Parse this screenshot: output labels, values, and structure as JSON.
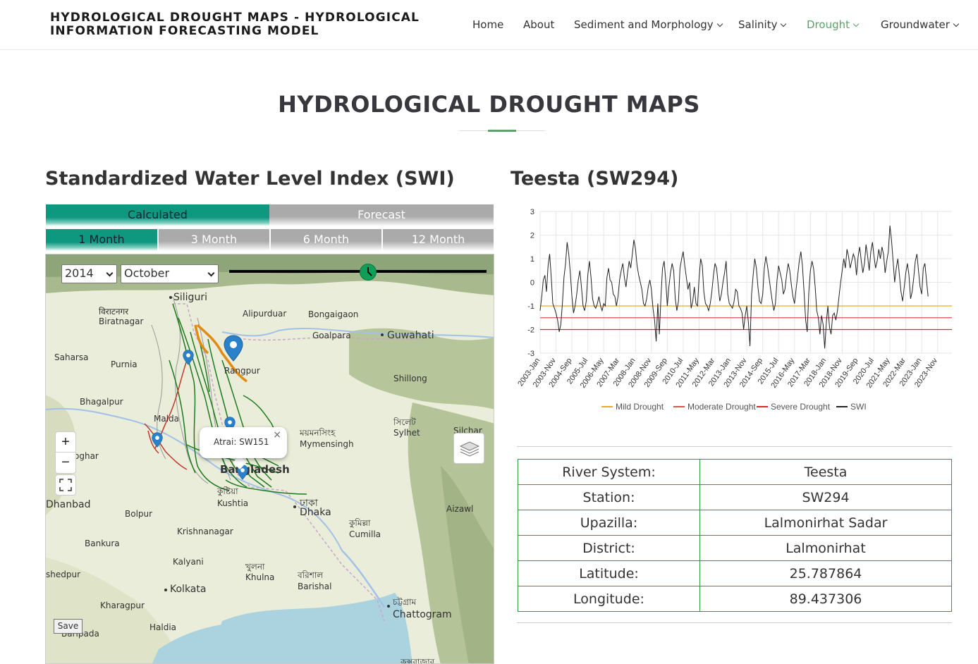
{
  "header": {
    "title_line1": "HYDROLOGICAL DROUGHT MAPS - HYDROLOGICAL",
    "title_line2": "INFORMATION FORECASTING MODEL",
    "nav": [
      {
        "label": "Home",
        "dropdown": false,
        "active": false
      },
      {
        "label": "About",
        "dropdown": false,
        "active": false
      },
      {
        "label": "Sediment and Morphology",
        "dropdown": true,
        "active": false
      },
      {
        "label": "Salinity",
        "dropdown": true,
        "active": false
      },
      {
        "label": "Drought",
        "dropdown": true,
        "active": true
      },
      {
        "label": "Groundwater",
        "dropdown": true,
        "active": false
      }
    ],
    "active_color": "#5aa469"
  },
  "page": {
    "heading": "HYDROLOGICAL DROUGHT MAPS"
  },
  "left": {
    "title": "Standardized Water Level Index (SWI)",
    "mode_tabs": [
      {
        "label": "Calculated",
        "active": true
      },
      {
        "label": "Forecast",
        "active": false
      }
    ],
    "period_tabs": [
      {
        "label": "1 Month",
        "active": true
      },
      {
        "label": "3 Month",
        "active": false
      },
      {
        "label": "6 Month",
        "active": false
      },
      {
        "label": "12 Month",
        "active": false
      }
    ],
    "year_select": "2014",
    "month_select": "October",
    "slider_level": 0.54,
    "zoom_in": "+",
    "zoom_out": "−",
    "fullscreen_icon": "fullscreen-icon",
    "layers_icon": "layers-icon",
    "save_label": "Save",
    "popup": {
      "text": "Atrai: SW151",
      "close": "×"
    },
    "map_labels": [
      {
        "id": "siliguri",
        "text": "Siliguri"
      },
      {
        "id": "biratnagar-bn",
        "text": "विराटनगर"
      },
      {
        "id": "biratnagar",
        "text": "Biratnagar"
      },
      {
        "id": "alipurduar",
        "text": "Alipurduar"
      },
      {
        "id": "bongaigaon",
        "text": "Bongaigaon"
      },
      {
        "id": "goalpara",
        "text": "Goalpara"
      },
      {
        "id": "guwahati",
        "text": "Guwahati"
      },
      {
        "id": "saharsa",
        "text": "Saharsa"
      },
      {
        "id": "purnia",
        "text": "Purnia"
      },
      {
        "id": "rangpur",
        "text": "Rangpur"
      },
      {
        "id": "shillong",
        "text": "Shillong"
      },
      {
        "id": "bhagalpur",
        "text": "Bhagalpur"
      },
      {
        "id": "malda",
        "text": "Malda"
      },
      {
        "id": "sylhet-bn",
        "text": "সিলেট"
      },
      {
        "id": "sylhet",
        "text": "Sylhet"
      },
      {
        "id": "silchar",
        "text": "Silchar"
      },
      {
        "id": "mymensingh-bn",
        "text": "ময়মনসিংহ"
      },
      {
        "id": "mymensingh",
        "text": "Mymensingh"
      },
      {
        "id": "deoghar",
        "text": "oghar"
      },
      {
        "id": "bangladesh",
        "text": "Bangladesh"
      },
      {
        "id": "dhanbad",
        "text": "Dhanbad"
      },
      {
        "id": "kushtia-bn",
        "text": "কুষ্টিয়া"
      },
      {
        "id": "kushtia",
        "text": "Kushtia"
      },
      {
        "id": "dhaka-bn",
        "text": "ঢাকা"
      },
      {
        "id": "dhaka",
        "text": "Dhaka"
      },
      {
        "id": "aizawl",
        "text": "Aizawl"
      },
      {
        "id": "bolpur",
        "text": "Bolpur"
      },
      {
        "id": "comilla-bn",
        "text": "কুমিল্লা"
      },
      {
        "id": "comilla",
        "text": "Cumilla"
      },
      {
        "id": "krishnanagar",
        "text": "Krishnanagar"
      },
      {
        "id": "bankura",
        "text": "Bankura"
      },
      {
        "id": "kalyani",
        "text": "Kalyani"
      },
      {
        "id": "khulna-bn",
        "text": "খুলনা"
      },
      {
        "id": "khulna",
        "text": "Khulna"
      },
      {
        "id": "barishal-bn",
        "text": "বরিশাল"
      },
      {
        "id": "barishal",
        "text": "Barishal"
      },
      {
        "id": "medinipur",
        "text": "shedpur"
      },
      {
        "id": "kolkata",
        "text": "Kolkata"
      },
      {
        "id": "kharagpur",
        "text": "Kharagpur"
      },
      {
        "id": "chattogram-bn",
        "text": "চট্টগ্রাম"
      },
      {
        "id": "chattogram",
        "text": "Chattogram"
      },
      {
        "id": "haldia",
        "text": "Haldia"
      },
      {
        "id": "baripada",
        "text": "Baripada"
      },
      {
        "id": "coxs-bn",
        "text": "কক্সবাজার"
      }
    ]
  },
  "right": {
    "title": "Teesta (SW294)",
    "table": [
      {
        "label": "River System:",
        "value": "Teesta"
      },
      {
        "label": "Station:",
        "value": "SW294"
      },
      {
        "label": "Upazilla:",
        "value": "Lalmonirhat Sadar"
      },
      {
        "label": "District:",
        "value": "Lalmonirhat"
      },
      {
        "label": "Latitude:",
        "value": "25.787864"
      },
      {
        "label": "Longitude:",
        "value": "89.437306"
      }
    ]
  },
  "chart_data": {
    "type": "line",
    "title": "",
    "xlabel": "",
    "ylabel": "",
    "ylim": [
      -3,
      3
    ],
    "yticks": [
      3,
      2,
      1,
      0,
      -1,
      -2,
      -3
    ],
    "xlim": [
      "2003-01",
      "2024-08"
    ],
    "x_tick_labels": [
      "2003-Jan",
      "2003-Nov",
      "2004-Sep",
      "2005-Jul",
      "2006-May",
      "2007-Mar",
      "2008-Jan",
      "2008-Nov",
      "2009-Sep",
      "2010-Jul",
      "2011-May",
      "2012-Mar",
      "2013-Jan",
      "2013-Nov",
      "2014-Sep",
      "2015-Jul",
      "2016-May",
      "2017-Mar",
      "2018-Jan",
      "2018-Nov",
      "2019-Sep",
      "2020-Jul",
      "2021-May",
      "2022-Mar",
      "2023-Jan",
      "2023-Nov"
    ],
    "grid": true,
    "legend_position": "bottom",
    "series": [
      {
        "name": "Mild Drought",
        "color": "#f5a623",
        "y": -1
      },
      {
        "name": "Moderate Drought",
        "color": "#d9534f",
        "y": -1.5
      },
      {
        "name": "Severe Drought",
        "color": "#e0262d",
        "y": -2
      },
      {
        "name": "SWI",
        "color": "#222222",
        "x_start": "2003-01",
        "x_step": "1 month",
        "values": [
          -1.2,
          -0.6,
          0.1,
          0.3,
          -0.4,
          0.7,
          1.2,
          0.2,
          -0.9,
          -1.1,
          -1.3,
          -1.6,
          -2.1,
          -1.8,
          -0.9,
          0.2,
          0.8,
          1.7,
          1.2,
          0.4,
          -0.6,
          -1.3,
          -1.0,
          -0.5,
          0.1,
          0.5,
          -0.2,
          -1.0,
          -1.2,
          -0.8,
          0.3,
          0.9,
          0.2,
          -0.7,
          -1.0,
          -1.1,
          -0.9,
          -0.6,
          -1.0,
          -1.2,
          -0.9,
          -1.0,
          0.2,
          0.6,
          0.1,
          0.0,
          -0.5,
          -0.6,
          -1.0,
          -0.6,
          0.1,
          0.5,
          0.8,
          0.2,
          -0.2,
          0.4,
          0.9,
          0.6,
          1.2,
          1.8,
          1.4,
          0.7,
          0.3,
          0.0,
          -0.3,
          -0.9,
          -1.0,
          -0.7,
          -0.2,
          0.1,
          -0.3,
          -1.1,
          -1.6,
          -2.5,
          -0.9,
          -2.2,
          -0.6,
          0.6,
          0.9,
          0.1,
          -1.0,
          -0.2,
          0.4,
          0.8,
          0.5,
          -0.7,
          -1.2,
          -0.8,
          0.6,
          1.0,
          1.3,
          0.7,
          0.2,
          -0.3,
          0.0,
          -1.1,
          -0.8,
          -0.2,
          -0.9,
          -1.0,
          0.2,
          1.0,
          0.7,
          -0.4,
          -0.9,
          -1.0,
          -1.2,
          -0.9,
          -0.4,
          0.3,
          0.8,
          0.6,
          -0.1,
          -0.8,
          -0.5,
          0.0,
          0.4,
          0.9,
          -0.5,
          -0.9,
          -1.0,
          -1.1,
          -0.8,
          -0.3,
          -0.4,
          -1.0,
          -1.1,
          -1.3,
          -2.0,
          -1.4,
          -1.0,
          -1.7,
          -2.7,
          -0.5,
          0.3,
          1.0,
          0.6,
          -0.2,
          -0.8,
          -0.9,
          -0.5,
          0.6,
          1.1,
          0.7,
          0.2,
          -0.3,
          -0.8,
          -1.2,
          -0.9,
          0.1,
          0.7,
          0.4,
          0.1,
          -0.5,
          -0.3,
          0.3,
          0.8,
          0.5,
          -0.1,
          -0.6,
          -0.9,
          -0.3,
          0.3,
          0.9,
          1.3,
          0.7,
          -0.4,
          -1.6,
          -2.1,
          -0.4,
          0.5,
          0.9,
          0.6,
          -0.2,
          -1.2,
          -1.5,
          -2.2,
          -1.4,
          -1.8,
          -2.8,
          -1.7,
          -1.0,
          -1.9,
          -2.2,
          -1.4,
          -1.3,
          -1.6,
          -1.2,
          -0.6,
          0.0,
          0.5,
          1.0,
          0.6,
          1.4,
          1.1,
          0.6,
          0.9,
          1.2,
          1.0,
          0.3,
          1.1,
          1.5,
          0.9,
          0.4,
          0.8,
          1.6,
          1.1,
          0.5,
          1.3,
          1.7,
          1.1,
          0.6,
          0.9,
          1.4,
          1.0,
          1.5,
          1.2,
          0.4,
          0.9,
          1.3,
          2.4,
          1.8,
          0.9,
          0.0,
          0.6,
          1.0,
          0.3,
          -0.4,
          -0.8,
          -0.2,
          0.4,
          0.8,
          0.3,
          -0.7,
          -0.4,
          0.2,
          0.9,
          1.2,
          0.5,
          -0.2,
          -0.5,
          0.6,
          0.8,
          0.1,
          -0.6
        ]
      }
    ]
  }
}
